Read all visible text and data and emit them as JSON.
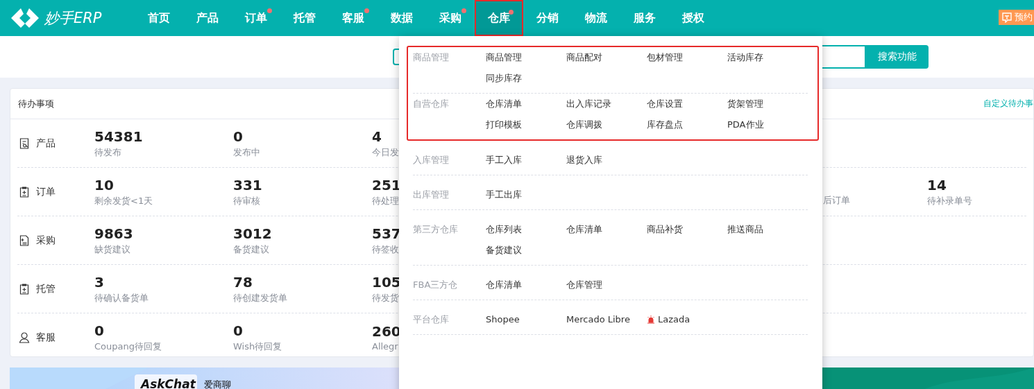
{
  "header": {
    "logo": "妙手ERP",
    "nav": [
      {
        "label": "首页",
        "selected": false,
        "badge": false,
        "highlighted": false
      },
      {
        "label": "产品",
        "selected": false,
        "badge": false,
        "highlighted": false
      },
      {
        "label": "订单",
        "selected": false,
        "badge": true,
        "highlighted": false
      },
      {
        "label": "托管",
        "selected": false,
        "badge": false,
        "highlighted": false
      },
      {
        "label": "客服",
        "selected": false,
        "badge": true,
        "highlighted": false
      },
      {
        "label": "数据",
        "selected": false,
        "badge": false,
        "highlighted": false
      },
      {
        "label": "采购",
        "selected": false,
        "badge": true,
        "highlighted": false
      },
      {
        "label": "仓库",
        "selected": true,
        "badge": true,
        "highlighted": true
      },
      {
        "label": "分销",
        "selected": false,
        "badge": false,
        "highlighted": false
      },
      {
        "label": "物流",
        "selected": false,
        "badge": false,
        "highlighted": false
      },
      {
        "label": "服务",
        "selected": false,
        "badge": false,
        "highlighted": false
      },
      {
        "label": "授权",
        "selected": false,
        "badge": false,
        "highlighted": false
      }
    ],
    "booking_button": "预约"
  },
  "search": {
    "button": "搜索功能"
  },
  "todo": {
    "title": "待办事项",
    "customize_link": "自定义待办事",
    "rows": [
      {
        "label": "产品",
        "cells": [
          {
            "value": "54381",
            "label": "待发布"
          },
          {
            "value": "0",
            "label": "发布中"
          },
          {
            "value": "4",
            "label": "今日发"
          }
        ]
      },
      {
        "label": "订单",
        "cells": [
          {
            "value": "10",
            "label": "剩余发货<1天"
          },
          {
            "value": "331",
            "label": "待审核"
          },
          {
            "value": "251",
            "label": "待处理"
          },
          {
            "kind": "partial",
            "label": "后订单"
          },
          {
            "value": "14",
            "label": "待补录单号"
          }
        ]
      },
      {
        "label": "采购",
        "cells": [
          {
            "value": "9863",
            "label": "缺货建议"
          },
          {
            "value": "3012",
            "label": "备货建议"
          },
          {
            "value": "537",
            "label": "待签收"
          }
        ]
      },
      {
        "label": "托管",
        "cells": [
          {
            "value": "3",
            "label": "待确认备货单"
          },
          {
            "value": "78",
            "label": "待创建发货单"
          },
          {
            "value": "105",
            "label": "待发货"
          }
        ]
      },
      {
        "label": "客服",
        "cells": [
          {
            "value": "0",
            "label": "Coupang待回复"
          },
          {
            "value": "0",
            "label": "Wish待回复"
          },
          {
            "value": "260",
            "label": "Allegr"
          }
        ]
      }
    ]
  },
  "banner": {
    "brand": "AskChat",
    "brand_cn": "爱商聊"
  },
  "dropdown": {
    "groups": [
      {
        "highlighted": true,
        "sections": [
          {
            "label": "商品管理",
            "items": [
              {
                "label": "商品管理"
              },
              {
                "label": "商品配对"
              },
              {
                "label": "包材管理"
              },
              {
                "label": "活动库存"
              },
              {
                "label": "同步库存"
              }
            ]
          },
          {
            "label": "自营仓库",
            "items": [
              {
                "label": "仓库清单"
              },
              {
                "label": "出入库记录"
              },
              {
                "label": "仓库设置"
              },
              {
                "label": "货架管理"
              },
              {
                "label": "打印模板"
              },
              {
                "label": "仓库调拨"
              },
              {
                "label": "库存盘点"
              },
              {
                "label": "PDA作业"
              }
            ]
          }
        ]
      },
      {
        "highlighted": false,
        "sections": [
          {
            "label": "入库管理",
            "items": [
              {
                "label": "手工入库"
              },
              {
                "label": "退货入库"
              }
            ]
          },
          {
            "label": "出库管理",
            "items": [
              {
                "label": "手工出库"
              }
            ]
          },
          {
            "label": "第三方仓库",
            "items": [
              {
                "label": "仓库列表"
              },
              {
                "label": "仓库清单"
              },
              {
                "label": "商品补货"
              },
              {
                "label": "推送商品"
              },
              {
                "label": "备货建议"
              }
            ]
          },
          {
            "label": "FBA三方仓",
            "items": [
              {
                "label": "仓库清单"
              },
              {
                "label": "仓库管理"
              }
            ]
          },
          {
            "label": "平台仓库",
            "items": [
              {
                "label": "Shopee"
              },
              {
                "label": "Mercado Libre"
              },
              {
                "label": "Lazada",
                "kind": "flagged"
              }
            ]
          }
        ]
      }
    ]
  }
}
